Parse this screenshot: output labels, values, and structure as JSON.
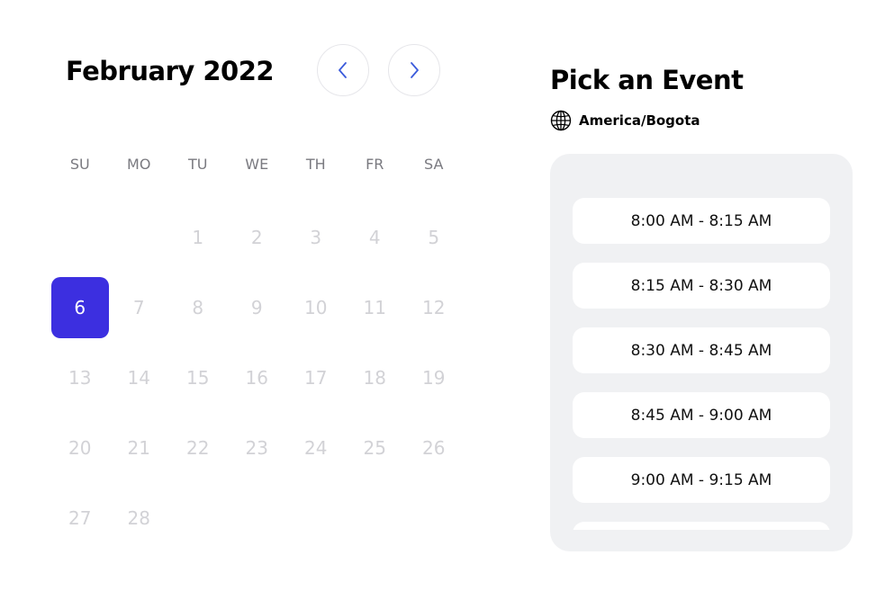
{
  "calendar": {
    "month_title": "February 2022",
    "prev_label": "previous month",
    "next_label": "next month",
    "weekdays": [
      "SU",
      "MO",
      "TU",
      "WE",
      "TH",
      "FR",
      "SA"
    ],
    "days": [
      {
        "label": "",
        "state": "empty"
      },
      {
        "label": "",
        "state": "empty"
      },
      {
        "label": "1",
        "state": "disabled"
      },
      {
        "label": "2",
        "state": "disabled"
      },
      {
        "label": "3",
        "state": "disabled"
      },
      {
        "label": "4",
        "state": "disabled"
      },
      {
        "label": "5",
        "state": "disabled"
      },
      {
        "label": "6",
        "state": "selected"
      },
      {
        "label": "7",
        "state": "disabled"
      },
      {
        "label": "8",
        "state": "disabled"
      },
      {
        "label": "9",
        "state": "disabled"
      },
      {
        "label": "10",
        "state": "disabled"
      },
      {
        "label": "11",
        "state": "disabled"
      },
      {
        "label": "12",
        "state": "disabled"
      },
      {
        "label": "13",
        "state": "disabled"
      },
      {
        "label": "14",
        "state": "disabled"
      },
      {
        "label": "15",
        "state": "disabled"
      },
      {
        "label": "16",
        "state": "disabled"
      },
      {
        "label": "17",
        "state": "disabled"
      },
      {
        "label": "18",
        "state": "disabled"
      },
      {
        "label": "19",
        "state": "disabled"
      },
      {
        "label": "20",
        "state": "disabled"
      },
      {
        "label": "21",
        "state": "disabled"
      },
      {
        "label": "22",
        "state": "disabled"
      },
      {
        "label": "23",
        "state": "disabled"
      },
      {
        "label": "24",
        "state": "disabled"
      },
      {
        "label": "25",
        "state": "disabled"
      },
      {
        "label": "26",
        "state": "disabled"
      },
      {
        "label": "27",
        "state": "disabled"
      },
      {
        "label": "28",
        "state": "disabled"
      }
    ]
  },
  "events": {
    "title": "Pick an Event",
    "timezone": "America/Bogota",
    "timezone_icon": "globe-icon",
    "slots": [
      "8:00 AM - 8:15 AM",
      "8:15 AM - 8:30 AM",
      "8:30 AM - 8:45 AM",
      "8:45 AM - 9:00 AM",
      "9:00 AM - 9:15 AM",
      ""
    ]
  },
  "colors": {
    "accent": "#3c2fe0",
    "nav_arrow": "#3b5bdb",
    "panel_bg": "#f0f1f3",
    "disabled_day": "#d2d2d6",
    "weekday": "#7a7a80"
  }
}
